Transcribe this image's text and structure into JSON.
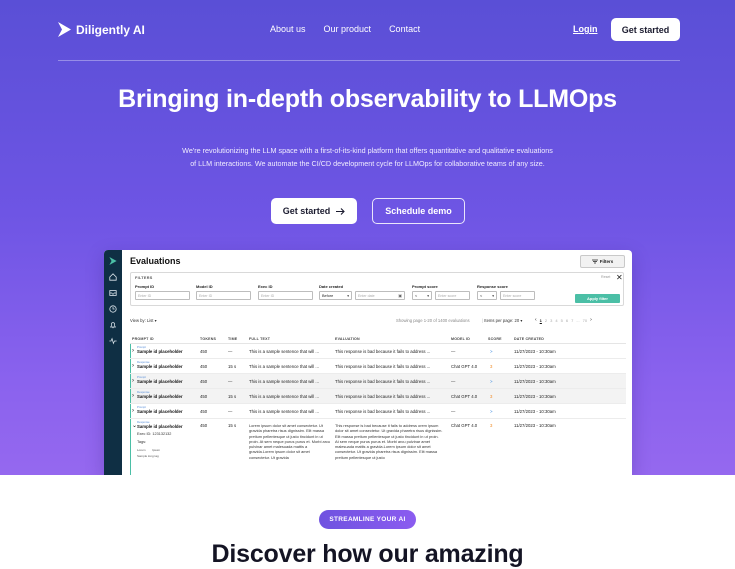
{
  "nav": {
    "brand": "Diligently AI",
    "links": [
      "About us",
      "Our product",
      "Contact"
    ],
    "login": "Login",
    "cta": "Get started"
  },
  "hero": {
    "headline": "Bringing in-depth observability to LLMOps",
    "subtext": "We're revolutionizing the LLM space with a first-of-its-kind platform that offers quantitative and qualitative evaluations of LLM interactions. We automate the CI/CD development cycle for LLMOps for collaborative teams of any size.",
    "primary_button": "Get started",
    "secondary_button": "Schedule demo"
  },
  "app": {
    "title": "Evaluations",
    "filters_button": "Filters",
    "filter_panel": {
      "title": "FILTERS",
      "reset": "Reset",
      "fields": [
        {
          "label": "Prompt ID",
          "placeholder": "Enter ID"
        },
        {
          "label": "Model ID",
          "placeholder": "Enter ID"
        },
        {
          "label": "Exec ID",
          "placeholder": "Enter ID"
        }
      ],
      "date_label": "Date created",
      "date_mode": "Before",
      "date_placeholder": "Enter date",
      "prompt_score_label": "Prompt score",
      "prompt_score_op": "<",
      "prompt_score_placeholder": "Enter score",
      "response_score_label": "Response score",
      "response_score_op": "<",
      "response_score_placeholder": "Enter score",
      "apply": "Apply filter"
    },
    "toolbar": {
      "view_by": "View by: List",
      "showing": "Showing page 1-20 of 1400 evaluations",
      "per_page": "Items per page: 20",
      "pages": [
        "1",
        "2",
        "3",
        "4",
        "5",
        "6",
        "7",
        "...",
        "70"
      ]
    },
    "columns": [
      "PROMPT ID",
      "TOKENS",
      "TIME",
      "FULL TEXT",
      "EVALUATION",
      "MODEL ID",
      "SCORE",
      "DATE CREATED"
    ],
    "rows": [
      {
        "tag": "Prompt",
        "name": "Sample id placeholder",
        "tokens": "450",
        "time": "—",
        "text": "This is a sample sentence that will ...",
        "eval": "This response is bad because it fails to address ...",
        "model": "—",
        "score": ">",
        "date": "11/27/2023 - 10:30am"
      },
      {
        "tag": "Response",
        "name": "Sample id placeholder",
        "tokens": "450",
        "time": "15 s",
        "text": "This is a sample sentence that will ...",
        "eval": "This response is bad because it fails to address ...",
        "model": "Chat GPT 4.0",
        "score": "3",
        "date": "11/27/2023 - 10:30am"
      },
      {
        "tag": "Prompt",
        "name": "Sample id placeholder",
        "tokens": "450",
        "time": "—",
        "text": "This is a sample sentence that will ...",
        "eval": "This response is bad because it fails to address ...",
        "model": "—",
        "score": ">",
        "date": "11/27/2023 - 10:30am"
      },
      {
        "tag": "Response",
        "name": "Sample id placeholder",
        "tokens": "450",
        "time": "15 s",
        "text": "This is a sample sentence that will ...",
        "eval": "This response is bad because it fails to address ...",
        "model": "Chat GPT 4.0",
        "score": "3",
        "date": "11/27/2023 - 10:30am"
      },
      {
        "tag": "Prompt",
        "name": "Sample id placeholder",
        "tokens": "450",
        "time": "—",
        "text": "This is a sample sentence that will ...",
        "eval": "This response is bad because it fails to address ...",
        "model": "—",
        "score": ">",
        "date": "11/27/2023 - 10:30am"
      }
    ],
    "expanded_row": {
      "tag": "Response",
      "name": "Sample id placeholder",
      "tokens": "450",
      "time": "15 s",
      "exec_id": "Exec ID: 123132132",
      "tags_label": "Tags:",
      "tag_items": [
        "Lorem",
        "Ipsum",
        "Sample long tag"
      ],
      "text": "Lorem ipsum dolor sit amet consectetur. Ut gravida pharetra risus dignissim. Elit massa pretium pellentesque ut justo tincidunt in ut proin. At sem neque purus purus et. Morbi arcu pulvinar amet malesuada mattis a gravida.Lorem ipsum dolor sit amet consectetur. Ut gravida",
      "eval": "This response is bad because it fails to address orem ipsum dolor sit amet consectetur. Ut gravida pharetra risus dignissim. Elit massa pretium pellentesque ut justo tincidunt in ut proin. At sem neque purus purus et. Morbi arcu pulvinar amet malesuada mattis a gravida.Lorem ipsum dolor sit amet consectetur. Ut gravida pharetra risus dignissim. Elit massa pretium pellentesque ut justo",
      "model": "Chat GPT 4.0",
      "score": "3",
      "date": "11/27/2023 - 10:30am"
    }
  },
  "section": {
    "badge": "STREAMLINE YOUR AI",
    "heading": "Discover how our amazing"
  },
  "colors": {
    "gradient_top": "#5a4fd6",
    "gradient_bottom": "#9568ef",
    "sidebar": "#0f2f44",
    "apply_button": "#4bbfa6",
    "score_blue": "#3d8de0",
    "score_orange": "#f08a24"
  },
  "icons": [
    "logo-arrow-icon",
    "home-icon",
    "inbox-icon",
    "clock-icon",
    "bell-icon",
    "activity-icon",
    "filter-icon",
    "close-icon",
    "arrow-right-icon",
    "chevron-down-icon",
    "calendar-icon"
  ]
}
